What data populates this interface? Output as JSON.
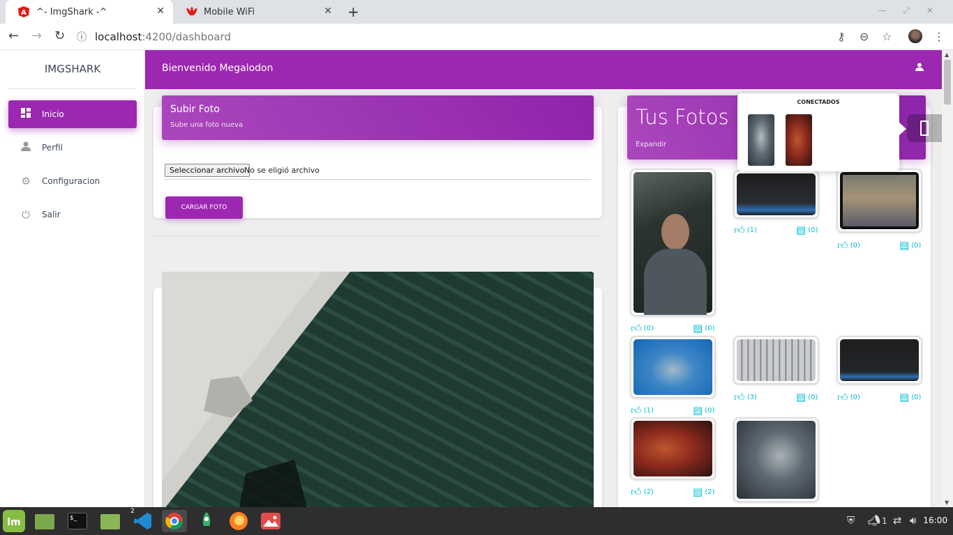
{
  "browser": {
    "tabs": [
      {
        "title": "^- ImgShark -^",
        "close": "✕"
      },
      {
        "title": "Mobile WiFi",
        "close": "✕"
      }
    ],
    "new_tab": "+",
    "url_host": "localhost",
    "url_path": ":4200/dashboard"
  },
  "sidebar": {
    "brand": "IMGSHARK",
    "items": [
      {
        "label": "Inicio",
        "icon": "dashboard-icon"
      },
      {
        "label": "Perfil",
        "icon": "person-icon"
      },
      {
        "label": "Configuracion",
        "icon": "gear-icon"
      },
      {
        "label": "Salir",
        "icon": "power-icon"
      }
    ]
  },
  "topbar": {
    "welcome": "Bienvenido Megalodon"
  },
  "upload": {
    "title": "Subir Foto",
    "subtitle": "Sube una foto nueva",
    "file_button": "Seleccionar archivo",
    "file_status": "No se eligió archivo",
    "submit": "CARGAR FOTO"
  },
  "gallery": {
    "title": "Tus Fotos",
    "expand": "Expandir",
    "photos": [
      {
        "likes": "(0)",
        "comments": "(0)"
      },
      {
        "likes": "(1)",
        "comments": "(0)"
      },
      {
        "likes": "(0)",
        "comments": "(0)"
      },
      {
        "likes": "(1)",
        "comments": "(0)"
      },
      {
        "likes": "(3)",
        "comments": "(0)"
      },
      {
        "likes": "(0)",
        "comments": "(0)"
      },
      {
        "likes": "(2)",
        "comments": "(2)"
      }
    ]
  },
  "online": {
    "title": "CONECTADOS"
  },
  "taskbar": {
    "badge": "2",
    "tray_count": "1",
    "clock": "16:00"
  },
  "colors": {
    "primary": "#9c27b0",
    "accent": "#00bcd4",
    "taskbar": "#2e2e2e"
  }
}
